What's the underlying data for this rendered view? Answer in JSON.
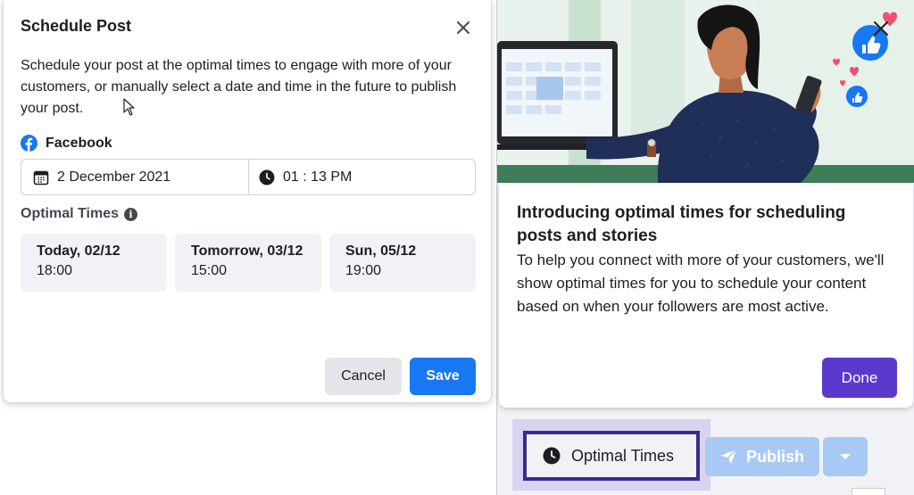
{
  "schedule_dialog": {
    "title": "Schedule Post",
    "description": "Schedule your post at the optimal times to engage with more of your customers, or manually select a date and time in the future to publish your post.",
    "platform": "Facebook",
    "date": "2 December 2021",
    "time": "01 : 13 PM",
    "optimal_times_label": "Optimal Times",
    "slots": [
      {
        "day": "Today, 02/12",
        "time": "18:00"
      },
      {
        "day": "Tomorrow, 03/12",
        "time": "15:00"
      },
      {
        "day": "Sun, 05/12",
        "time": "19:00"
      }
    ],
    "cancel_label": "Cancel",
    "save_label": "Save"
  },
  "intro_card": {
    "title": "Introducing optimal times for scheduling posts and stories",
    "body": "To help you connect with more of your customers, we'll show optimal times for you to schedule your content based on when your followers are most active.",
    "done_label": "Done"
  },
  "toolbar": {
    "optimal_times_label": "Optimal Times",
    "publish_label": "Publish"
  },
  "colors": {
    "facebook_blue": "#1877f2",
    "done_purple": "#5a39cc",
    "highlight_outline": "#3b2a8c",
    "publish_disabled": "#a8c9f3"
  },
  "icons": [
    "close-icon",
    "facebook-icon",
    "calendar-icon",
    "clock-icon",
    "info-icon",
    "like-icon",
    "heart-icon",
    "send-icon",
    "chevron-down-icon"
  ]
}
